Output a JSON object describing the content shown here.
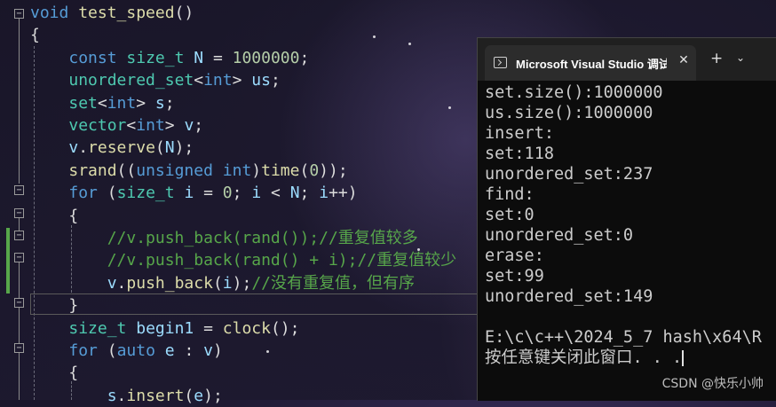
{
  "editor": {
    "lines": [
      [
        {
          "t": "void",
          "c": "kw"
        },
        {
          "t": " "
        },
        {
          "t": "test_speed",
          "c": "fn"
        },
        {
          "t": "()"
        }
      ],
      [
        {
          "t": "{"
        }
      ],
      [
        {
          "t": "    "
        },
        {
          "t": "const",
          "c": "kw"
        },
        {
          "t": " "
        },
        {
          "t": "size_t",
          "c": "ty"
        },
        {
          "t": " "
        },
        {
          "t": "N",
          "c": "vr"
        },
        {
          "t": " = "
        },
        {
          "t": "1000000",
          "c": "nm"
        },
        {
          "t": ";"
        }
      ],
      [
        {
          "t": "    "
        },
        {
          "t": "unordered_set",
          "c": "ty"
        },
        {
          "t": "<"
        },
        {
          "t": "int",
          "c": "kw"
        },
        {
          "t": "> "
        },
        {
          "t": "us",
          "c": "vr"
        },
        {
          "t": ";"
        }
      ],
      [
        {
          "t": "    "
        },
        {
          "t": "set",
          "c": "ty"
        },
        {
          "t": "<"
        },
        {
          "t": "int",
          "c": "kw"
        },
        {
          "t": "> "
        },
        {
          "t": "s",
          "c": "vr"
        },
        {
          "t": ";"
        }
      ],
      [
        {
          "t": "    "
        },
        {
          "t": "vector",
          "c": "ty"
        },
        {
          "t": "<"
        },
        {
          "t": "int",
          "c": "kw"
        },
        {
          "t": "> "
        },
        {
          "t": "v",
          "c": "vr"
        },
        {
          "t": ";"
        }
      ],
      [
        {
          "t": "    "
        },
        {
          "t": "v",
          "c": "vr"
        },
        {
          "t": "."
        },
        {
          "t": "reserve",
          "c": "fn"
        },
        {
          "t": "("
        },
        {
          "t": "N",
          "c": "vr"
        },
        {
          "t": ");"
        }
      ],
      [
        {
          "t": "    "
        },
        {
          "t": "srand",
          "c": "fn"
        },
        {
          "t": "(("
        },
        {
          "t": "unsigned int",
          "c": "kw"
        },
        {
          "t": ")"
        },
        {
          "t": "time",
          "c": "fn"
        },
        {
          "t": "("
        },
        {
          "t": "0",
          "c": "nm"
        },
        {
          "t": "));"
        }
      ],
      [
        {
          "t": "    "
        },
        {
          "t": "for",
          "c": "kw"
        },
        {
          "t": " ("
        },
        {
          "t": "size_t",
          "c": "ty"
        },
        {
          "t": " "
        },
        {
          "t": "i",
          "c": "vr"
        },
        {
          "t": " = "
        },
        {
          "t": "0",
          "c": "nm"
        },
        {
          "t": "; "
        },
        {
          "t": "i",
          "c": "vr"
        },
        {
          "t": " < "
        },
        {
          "t": "N",
          "c": "vr"
        },
        {
          "t": "; "
        },
        {
          "t": "i",
          "c": "vr"
        },
        {
          "t": "++)"
        }
      ],
      [
        {
          "t": "    {"
        }
      ],
      [
        {
          "t": "        "
        },
        {
          "t": "//v.push_back(rand());//重复值较多",
          "c": "cm"
        }
      ],
      [
        {
          "t": "        "
        },
        {
          "t": "//v.push_back(rand() + i);//重复值较少",
          "c": "cm"
        }
      ],
      [
        {
          "t": "        "
        },
        {
          "t": "v",
          "c": "vr"
        },
        {
          "t": "."
        },
        {
          "t": "push_back",
          "c": "fn"
        },
        {
          "t": "("
        },
        {
          "t": "i",
          "c": "vr"
        },
        {
          "t": ");"
        },
        {
          "t": "//没有重复值，但有序",
          "c": "cm"
        }
      ],
      [
        {
          "t": "    }"
        }
      ],
      [
        {
          "t": "    "
        },
        {
          "t": "size_t",
          "c": "ty"
        },
        {
          "t": " "
        },
        {
          "t": "begin1",
          "c": "vr"
        },
        {
          "t": " = "
        },
        {
          "t": "clock",
          "c": "fn"
        },
        {
          "t": "();"
        }
      ],
      [
        {
          "t": "    "
        },
        {
          "t": "for",
          "c": "kw"
        },
        {
          "t": " ("
        },
        {
          "t": "auto",
          "c": "kw"
        },
        {
          "t": " "
        },
        {
          "t": "e",
          "c": "vr"
        },
        {
          "t": " : "
        },
        {
          "t": "v",
          "c": "vr"
        },
        {
          "t": ")"
        }
      ],
      [
        {
          "t": "    {"
        }
      ],
      [
        {
          "t": "        "
        },
        {
          "t": "s",
          "c": "vr"
        },
        {
          "t": "."
        },
        {
          "t": "insert",
          "c": "fn"
        },
        {
          "t": "("
        },
        {
          "t": "e",
          "c": "vr"
        },
        {
          "t": ");"
        }
      ]
    ]
  },
  "console": {
    "tab_title": "Microsoft Visual Studio 调试控制台",
    "close_glyph": "✕",
    "new_tab_glyph": "+",
    "dropdown_glyph": "⌄",
    "lines": [
      "set.size():1000000",
      "us.size():1000000",
      "insert:",
      "set:118",
      "unordered_set:237",
      "find:",
      "set:0",
      "unordered_set:0",
      "erase:",
      "set:99",
      "unordered_set:149",
      "",
      "E:\\c\\c++\\2024_5_7 hash\\x64\\R",
      "按任意键关闭此窗口. . ."
    ]
  },
  "watermark": "CSDN @快乐小帅"
}
